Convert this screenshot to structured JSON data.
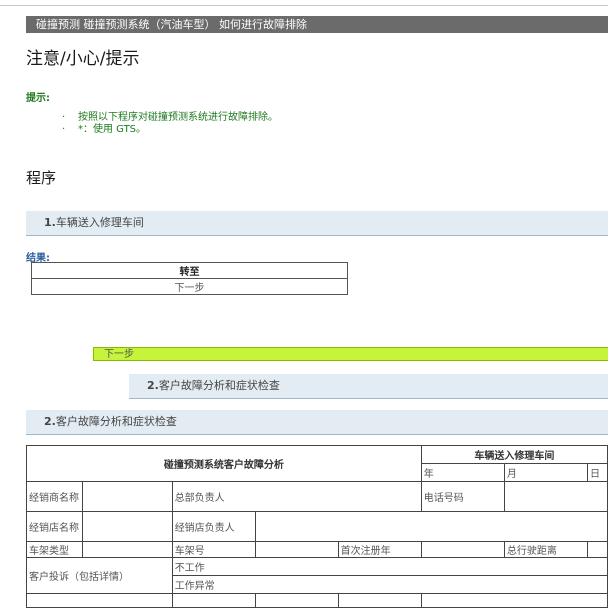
{
  "title_bar": "碰撞预测  碰撞预测系统（汽油车型）  如何进行故障排除",
  "heading": "注意/小心/提示",
  "hint": {
    "label": "提示:",
    "items": [
      {
        "bullet": "·",
        "text": "按照以下程序对碰撞预测系统进行故障排除。"
      },
      {
        "bullet": "·",
        "text": "*：使用 GTS。"
      }
    ]
  },
  "procedure_heading": "程序",
  "step1": {
    "number": "1.",
    "label": "车辆送入修理车间"
  },
  "result": {
    "label": "结果:",
    "goto_header": "转至",
    "goto_value": "下一步"
  },
  "next_step_label": "下一步",
  "step2": {
    "number": "2.",
    "label": "客户故障分析和症状检查"
  },
  "step2_repeat": {
    "number": "2.",
    "label": "客户故障分析和症状检查"
  },
  "form": {
    "title": "碰撞预测系统客户故障分析",
    "arrival_title": "车辆送入修理车间",
    "year": "年",
    "month": "月",
    "day": "日",
    "dealer_name": "经销商名称",
    "hq_manager": "总部负责人",
    "phone": "电话号码",
    "store_name": "经销店名称",
    "store_manager": "经销店负责人",
    "frame_type": "车架类型",
    "frame_no": "车架号",
    "first_reg_year": "首次注册年",
    "total_mileage": "总行驶距离",
    "complaint": "客户投诉（包括详情）",
    "not_working": "不工作",
    "malfunction": "工作异常"
  }
}
